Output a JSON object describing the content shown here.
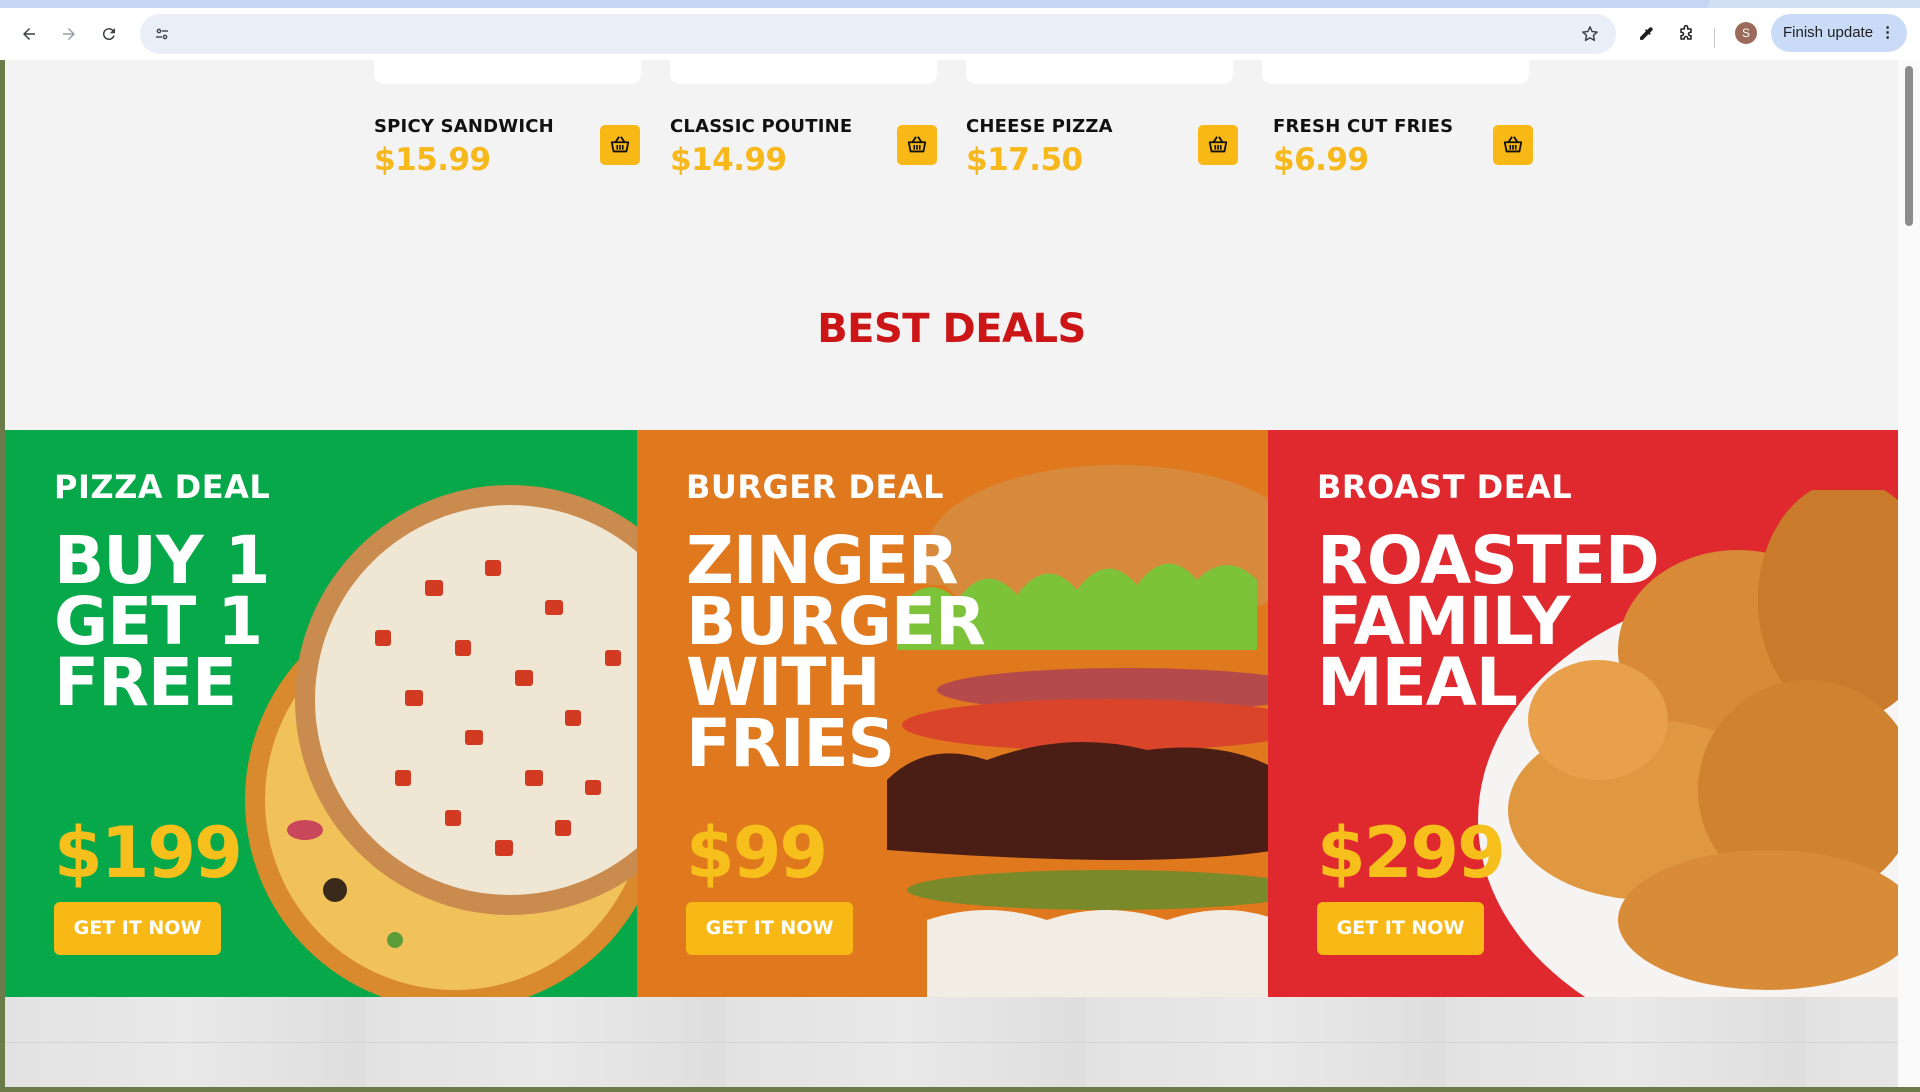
{
  "browser": {
    "finish_update_label": "Finish update",
    "avatar_initial": "S",
    "more_menu": "⋮"
  },
  "products": [
    {
      "name": "SPICY SANDWICH",
      "price": "$15.99"
    },
    {
      "name": "CLASSIC POUTINE",
      "price": "$14.99"
    },
    {
      "name": "CHEESE PIZZA",
      "price": "$17.50"
    },
    {
      "name": "FRESH CUT FRIES",
      "price": "$6.99"
    }
  ],
  "section_title": "BEST DEALS",
  "deals": [
    {
      "label": "PIZZA DEAL",
      "headline": [
        "BUY 1",
        "GET 1",
        "FREE"
      ],
      "price": "$199",
      "cta": "GET IT NOW",
      "bg_color": "#07a84a"
    },
    {
      "label": "BURGER DEAL",
      "headline": [
        "ZINGER",
        "BURGER",
        "WITH",
        "FRIES"
      ],
      "price": "$99",
      "cta": "GET IT NOW",
      "bg_color": "#e0781d"
    },
    {
      "label": "BROAST DEAL",
      "headline": [
        "ROASTED",
        "FAMILY",
        "MEAL"
      ],
      "price": "$299",
      "cta": "GET IT NOW",
      "bg_color": "#e0292e"
    }
  ],
  "colors": {
    "accent_yellow": "#f8b916",
    "title_red": "#cc1517"
  }
}
